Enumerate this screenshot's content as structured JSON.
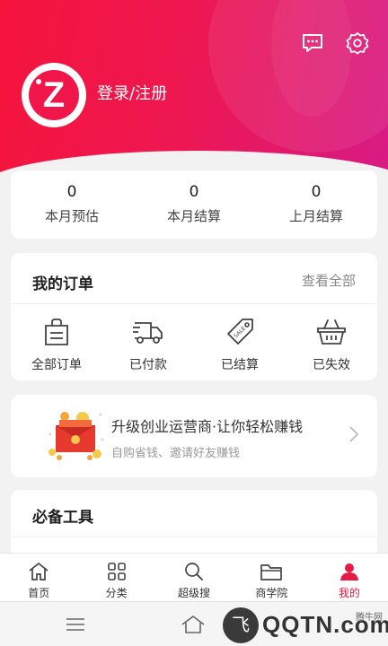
{
  "header": {
    "login_label": "登录/注册",
    "avatar_letter": "Z",
    "message_icon": "chat-bubble-icon",
    "settings_icon": "gear-icon",
    "gradient_from": "#f5143c",
    "gradient_to": "#d81b84"
  },
  "stats": [
    {
      "value": "0",
      "label": "本月预估"
    },
    {
      "value": "0",
      "label": "本月结算"
    },
    {
      "value": "0",
      "label": "上月结算"
    }
  ],
  "orders": {
    "title": "我的订单",
    "view_all": "查看全部",
    "items": [
      {
        "label": "全部订单",
        "icon": "order-bag-icon"
      },
      {
        "label": "已付款",
        "icon": "delivery-truck-icon"
      },
      {
        "label": "已结算",
        "icon": "sale-tag-icon"
      },
      {
        "label": "已失效",
        "icon": "basket-icon"
      }
    ]
  },
  "banner": {
    "title": "升级创业运营商·让你轻松赚钱",
    "subtitle": "自购省钱、邀请好友赚钱",
    "image_icon": "red-envelope-coins-icon",
    "arrow_icon": "chevron-right-icon"
  },
  "tools": {
    "title": "必备工具"
  },
  "tabbar": {
    "active_color": "#e61a45",
    "items": [
      {
        "label": "首页",
        "icon": "home-icon"
      },
      {
        "label": "分类",
        "icon": "grid-icon"
      },
      {
        "label": "超级搜",
        "icon": "search-icon"
      },
      {
        "label": "商学院",
        "icon": "folder-icon"
      },
      {
        "label": "我的",
        "icon": "user-icon"
      }
    ]
  },
  "watermark": {
    "logo_glyph": "飞",
    "brand": "QQTN.com",
    "tag": "腾牛网"
  }
}
